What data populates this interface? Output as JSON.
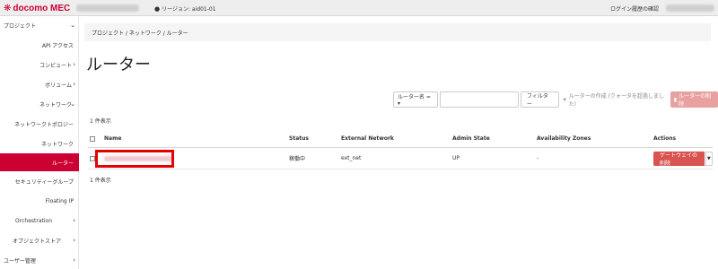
{
  "topbar": {
    "brand": "docomo MEC",
    "brand_icon": "docomo-logo-icon",
    "region_label": "リージョン: aid01-01",
    "login_history": "ログイン履歴の確認"
  },
  "sidebar": {
    "items": [
      {
        "label": "プロジェクト",
        "chevron": "⌄"
      },
      {
        "label": "API アクセス",
        "chevron": ""
      },
      {
        "label": "コンピュート",
        "chevron": "›"
      },
      {
        "label": "ボリューム",
        "chevron": "›"
      },
      {
        "label": "ネットワーク",
        "chevron": "⌄"
      },
      {
        "label": "ネットワークトポロジー",
        "chevron": ""
      },
      {
        "label": "ネットワーク",
        "chevron": ""
      },
      {
        "label": "ルーター",
        "chevron": "",
        "active": true
      },
      {
        "label": "セキュリティーグループ",
        "chevron": ""
      },
      {
        "label": "Floating IP",
        "chevron": ""
      },
      {
        "label": "Orchestration",
        "chevron": "›"
      },
      {
        "label": "オブジェクトストア",
        "chevron": "›"
      },
      {
        "label": "ユーザー管理",
        "chevron": "›"
      }
    ]
  },
  "breadcrumb": "プロジェクト / ネットワーク / ルーター",
  "page_title": "ルーター",
  "toolbar": {
    "filter_select": "ルーター名 = ▾",
    "filter_input_value": "",
    "filter_button": "フィルター",
    "create_label": "ルーターの作成 (クォータを超過しました)",
    "delete_label": "ルーターの削除"
  },
  "count_top": "1 件表示",
  "count_bottom": "1 件表示",
  "table": {
    "headers": [
      "Name",
      "Status",
      "External Network",
      "Admin State",
      "Availability Zones",
      "Actions"
    ],
    "rows": [
      {
        "name": "",
        "status": "稼働中",
        "external_network": "ext_net",
        "admin_state": "UP",
        "availability_zones": "-",
        "action": "ゲートウェイの削除"
      }
    ]
  },
  "colors": {
    "brand": "#cc0033",
    "danger": "#d9534f",
    "highlight": "#e60000"
  }
}
